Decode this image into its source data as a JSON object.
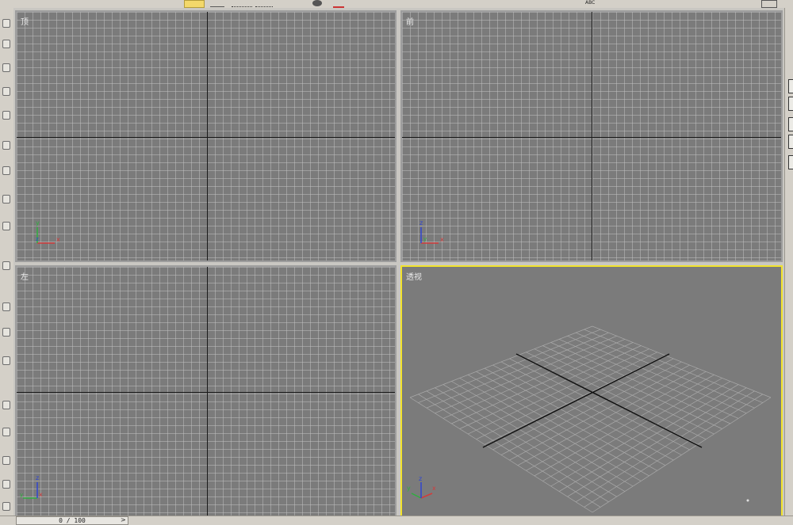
{
  "toolbar": {
    "buttons": [
      "move-tool",
      "select-tool",
      "rotate-tool",
      "scale-tool",
      "render-tool",
      "spelling-tool"
    ],
    "spelling_label": "ABC"
  },
  "viewports": {
    "top": {
      "label": "顶"
    },
    "front": {
      "label": "前"
    },
    "left": {
      "label": "左"
    },
    "perspective": {
      "label": "透视",
      "active": true
    }
  },
  "gizmo_labels": {
    "x": "x",
    "y": "y",
    "z": "z"
  },
  "status": {
    "frame_counter": "0 / 100",
    "arrow": ">"
  },
  "colors": {
    "active_border": "#f2e32c",
    "viewport_bg": "#7b7b7b",
    "x_axis": "#d33b3b",
    "y_axis": "#2fae3f",
    "z_axis": "#2f45d1"
  }
}
